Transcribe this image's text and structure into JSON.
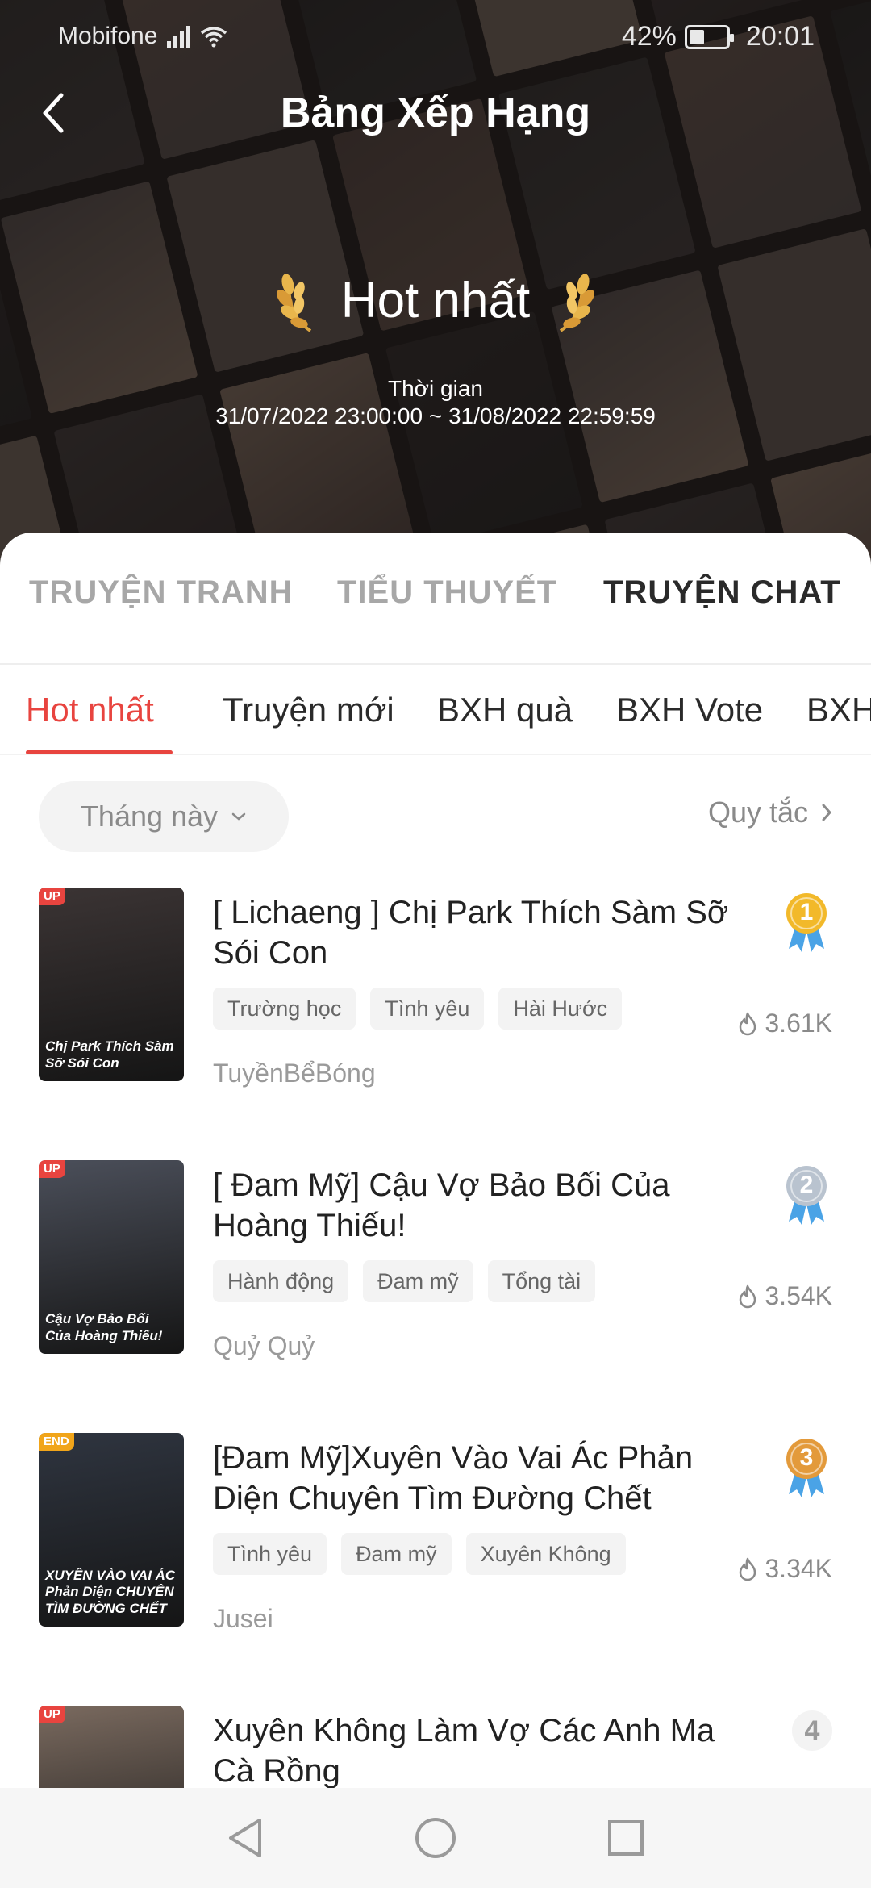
{
  "status": {
    "carrier": "Mobifone",
    "battery_percent": "42%",
    "battery_level": 0.42,
    "time": "20:01"
  },
  "header": {
    "title": "Bảng Xếp Hạng",
    "ranking_title": "Hot nhất",
    "time_label": "Thời gian",
    "time_range": "31/07/2022 23:00:00 ~ 31/08/2022 22:59:59"
  },
  "category_tabs": [
    {
      "label": "TRUYỆN TRANH",
      "active": false
    },
    {
      "label": "TIỂU THUYẾT",
      "active": false
    },
    {
      "label": "TRUYỆN CHAT",
      "active": true
    }
  ],
  "sub_tabs": [
    {
      "label": "Hot nhất",
      "active": true
    },
    {
      "label": "Truyện mới",
      "active": false
    },
    {
      "label": "BXH quà",
      "active": false
    },
    {
      "label": "BXH Vote",
      "active": false
    },
    {
      "label": "BXH",
      "active": false
    }
  ],
  "filter": {
    "selected": "Tháng này",
    "rules_label": "Quy tắc"
  },
  "items": [
    {
      "rank": "1",
      "title": "[ Lichaeng ] Chị Park Thích Sàm Sỡ Sói Con",
      "tags": [
        "Trường học",
        "Tình yêu",
        "Hài Hước"
      ],
      "author": "TuyềnBểBóng",
      "hot": "3.61K",
      "badge": "UP",
      "cover_text": "Chị Park Thích Sàm Sỡ Sói Con",
      "cover_color": "#3b3434"
    },
    {
      "rank": "2",
      "title": "[ Đam Mỹ] Cậu Vợ Bảo Bối Của Hoàng Thiếu!",
      "tags": [
        "Hành động",
        "Đam mỹ",
        "Tổng tài"
      ],
      "author": "Quỷ Quỷ",
      "hot": "3.54K",
      "badge": "UP",
      "cover_text": "Cậu Vợ Bảo Bối Của Hoàng Thiếu!",
      "cover_color": "#4b4f5a"
    },
    {
      "rank": "3",
      "title": "[Đam Mỹ]Xuyên Vào Vai Ác Phản Diện Chuyên Tìm Đường Chết",
      "tags": [
        "Tình yêu",
        "Đam mỹ",
        "Xuyên Không"
      ],
      "author": "Jusei",
      "hot": "3.34K",
      "badge": "END",
      "cover_text": "XUYÊN VÀO VAI ÁC Phản Diện CHUYÊN TÌM ĐƯỜNG CHẾT",
      "cover_color": "#2f3540"
    },
    {
      "rank": "4",
      "title": "Xuyên Không Làm Vợ Các Anh Ma Cà Rồng",
      "tags": [],
      "author": "",
      "hot": "",
      "badge": "UP",
      "cover_text": "",
      "cover_color": "#7a6a5f"
    }
  ],
  "colors": {
    "accent": "#e8443f",
    "gold": "#f2b92a",
    "silver": "#b9c3cf",
    "bronze": "#e39a3b",
    "ribbon": "#4aa3e6"
  }
}
